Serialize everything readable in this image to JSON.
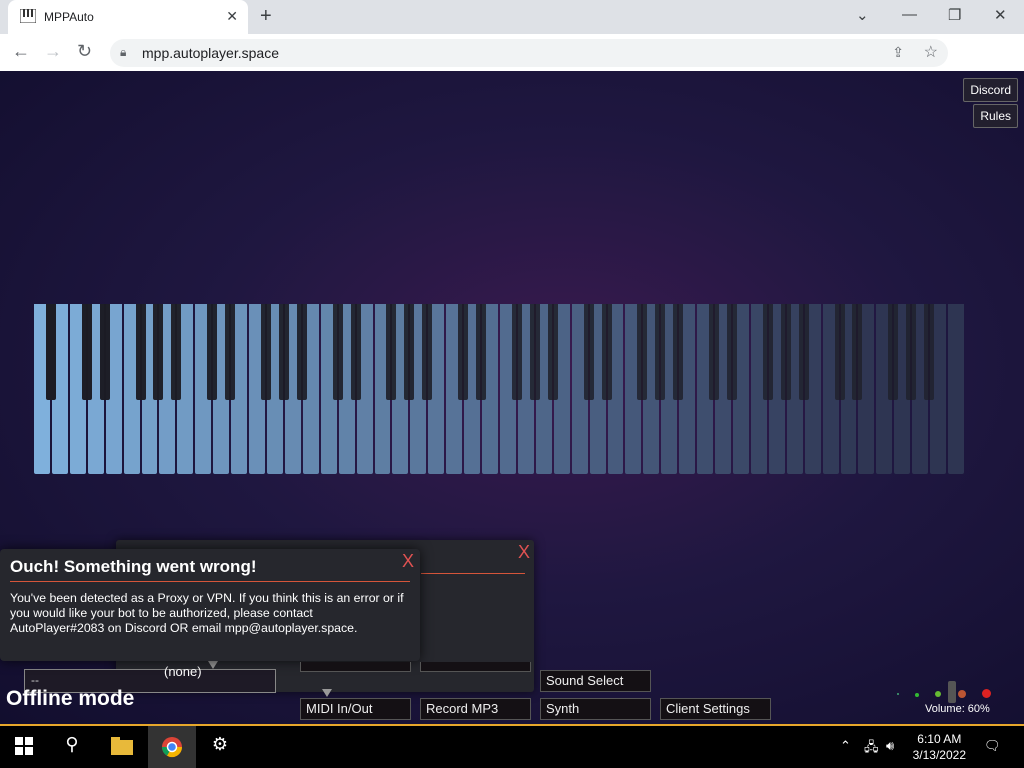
{
  "browser": {
    "tab_title": "MPPAuto",
    "tab_close": "✕",
    "new_tab": "+",
    "url": "mpp.autoplayer.space",
    "window_controls": {
      "minimize": "—",
      "restore": "❐",
      "close": "✕",
      "tab_list": "⌄"
    }
  },
  "page": {
    "links": {
      "discord": "Discord",
      "rules": "Rules"
    },
    "offline_text": "Offline mode",
    "select_value": "--",
    "buttons": {
      "midi": "MIDI In/Out",
      "record": "Record MP3",
      "synth": "Synth",
      "client_settings": "Client Settings",
      "sound_select": "Sound Select"
    },
    "volume_label": "Volume: 60%",
    "none_label": "(none)"
  },
  "error_modal": {
    "title": "Ouch! Something went wrong!",
    "message": "You've been detected as a Proxy or VPN. If you think this is an error or if you would like your bot to be authorized, please contact AutoPlayer#2083 on Discord OR email mpp@autoplayer.space.",
    "close": "X"
  },
  "back_modal": {
    "close": "X"
  },
  "taskbar": {
    "time": "6:10 AM",
    "date": "3/13/2022"
  },
  "colors": {
    "accent_red": "#e05252",
    "white_key_left": "#7fb0dc",
    "white_key_right": "#2e3552"
  }
}
